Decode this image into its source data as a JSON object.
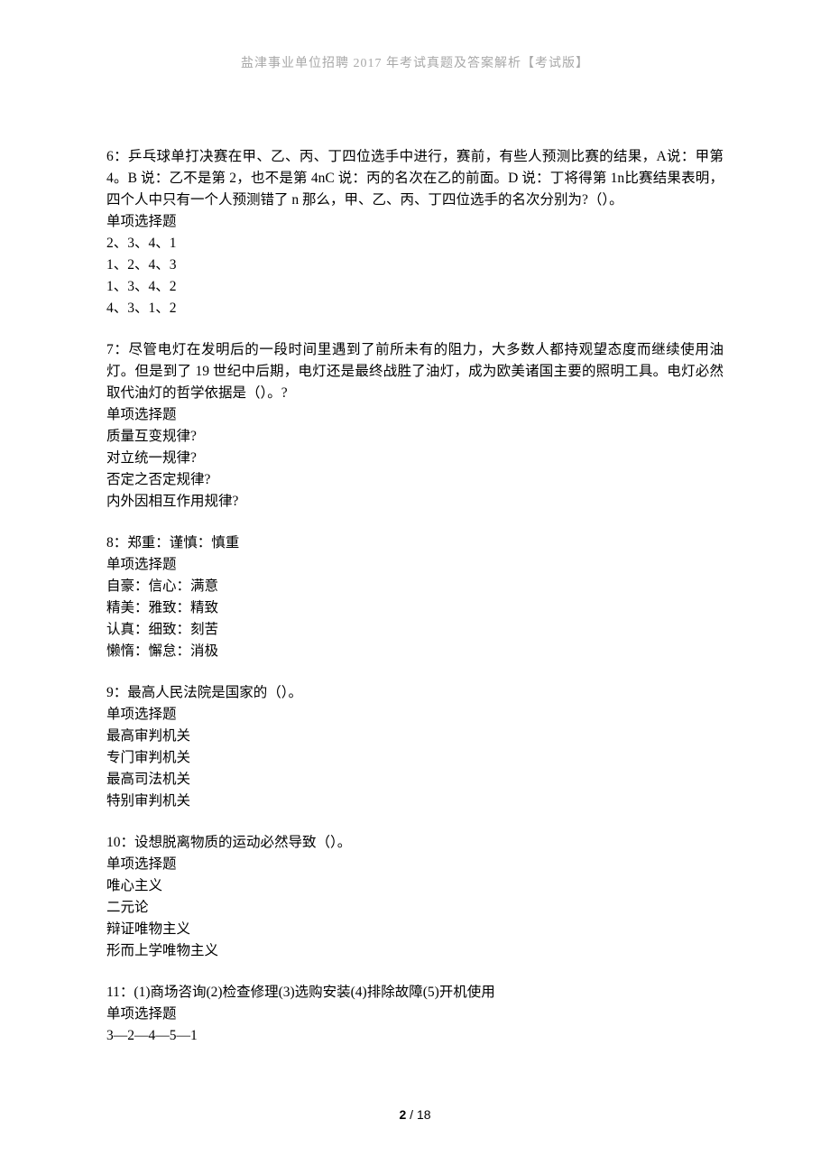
{
  "header": "盐津事业单位招聘 2017 年考试真题及答案解析【考试版】",
  "questions": [
    {
      "stem": "6：乒乓球单打决赛在甲、乙、丙、丁四位选手中进行，赛前，有些人预测比赛的结果，A说：甲第 4。B 说：乙不是第 2，也不是第 4nC 说：丙的名次在乙的前面。D 说：丁将得第 1n比赛结果表明，四个人中只有一个人预测错了 n 那么，甲、乙、丙、丁四位选手的名次分别为?（）。",
      "type": "单项选择题",
      "options": [
        "2、3、4、1",
        "1、2、4、3",
        "1、3、4、2",
        "4、3、1、2"
      ]
    },
    {
      "stem": "7：尽管电灯在发明后的一段时间里遇到了前所未有的阻力，大多数人都持观望态度而继续使用油灯。但是到了 19 世纪中后期，电灯还是最终战胜了油灯，成为欧美诸国主要的照明工具。电灯必然取代油灯的哲学依据是（）。?",
      "type": "单项选择题",
      "options": [
        "质量互变规律?",
        "对立统一规律?",
        "否定之否定规律?",
        "内外因相互作用规律?"
      ]
    },
    {
      "stem": "8：郑重：谨慎：慎重",
      "type": "单项选择题",
      "options": [
        "自豪：信心：满意",
        "精美：雅致：精致",
        "认真：细致：刻苦",
        "懒惰：懈怠：消极"
      ]
    },
    {
      "stem": "9：最高人民法院是国家的（）。",
      "type": "单项选择题",
      "options": [
        "最高审判机关",
        "专门审判机关",
        "最高司法机关",
        "特别审判机关"
      ]
    },
    {
      "stem": "10：设想脱离物质的运动必然导致（）。",
      "type": "单项选择题",
      "options": [
        "唯心主义",
        "二元论",
        "辩证唯物主义",
        "形而上学唯物主义"
      ]
    },
    {
      "stem": "11：(1)商场咨询(2)检查修理(3)选购安装(4)排除故障(5)开机使用",
      "type": "单项选择题",
      "options": [
        "3—2—4—5—1"
      ]
    }
  ],
  "footer": {
    "page": "2",
    "total": "18"
  }
}
